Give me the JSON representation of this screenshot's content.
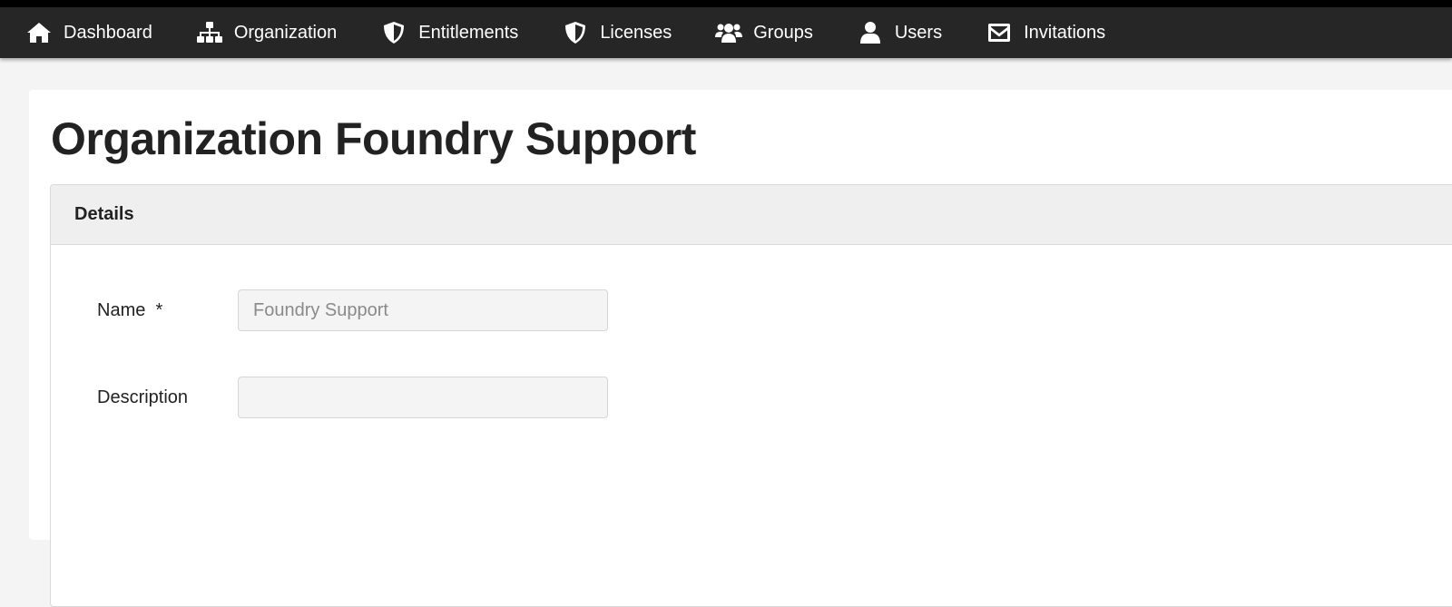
{
  "nav": {
    "items": [
      {
        "label": "Dashboard",
        "icon": "home-icon"
      },
      {
        "label": "Organization",
        "icon": "sitemap-icon"
      },
      {
        "label": "Entitlements",
        "icon": "shield-icon"
      },
      {
        "label": "Licenses",
        "icon": "shield-icon"
      },
      {
        "label": "Groups",
        "icon": "users-icon"
      },
      {
        "label": "Users",
        "icon": "user-icon"
      },
      {
        "label": "Invitations",
        "icon": "envelope-icon"
      }
    ]
  },
  "page": {
    "title": "Organization Foundry Support"
  },
  "details": {
    "header": "Details",
    "name_label": "Name  *",
    "name_value": "Foundry Support",
    "description_label": "Description",
    "description_value": ""
  },
  "colors": {
    "navbar_bg": "#262626",
    "page_bg": "#f4f4f4",
    "card_header_bg": "#efefef",
    "input_bg": "#f4f4f4"
  }
}
